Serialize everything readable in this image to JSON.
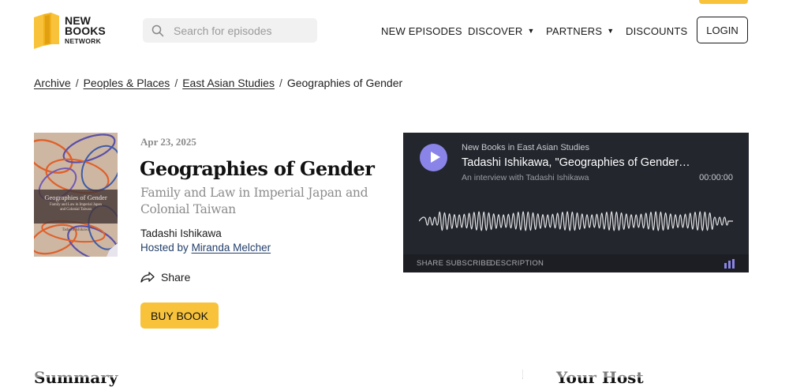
{
  "header": {
    "logo": {
      "line1": "NEW",
      "line2": "BOOKS",
      "line3": "NETWORK"
    },
    "search_placeholder": "Search for episodes",
    "nav": [
      "NEW EPISODES",
      "DISCOVER",
      "PARTNERS",
      "DISCOUNTS"
    ],
    "login": "LOGIN"
  },
  "breadcrumb": [
    "Archive",
    "Peoples & Places",
    "East Asian Studies",
    "Geographies of Gender"
  ],
  "book": {
    "cover": {
      "title": "Geographies of Gender",
      "subtitle_line1": "Family and Law in Imperial Japan",
      "subtitle_line2": "and Colonial Taiwan",
      "author": "Tadashi Ishikawa"
    },
    "date": "Apr 23, 2025",
    "title": "Geographies of Gender",
    "subtitle": "Family and Law in Imperial Japan and Colonial Taiwan",
    "author": "Tadashi Ishikawa",
    "hosted_prefix": "Hosted by",
    "host": "Miranda Melcher",
    "share": "Share",
    "buy": "BUY BOOK"
  },
  "player": {
    "show": "New Books in East Asian Studies",
    "episode": "Tadashi Ishikawa, \"Geographies of Gender…",
    "description": "An interview with Tadashi Ishikawa",
    "time": "00:00:00",
    "links": [
      "SHARE",
      "SUBSCRIBE",
      "DESCRIPTION"
    ],
    "accent": "#8b84e8"
  },
  "sections": {
    "summary": "Summary",
    "your_host": "Your Host"
  },
  "colors": {
    "brand_yellow": "#f8c33b",
    "player_bg": "#23262d"
  }
}
